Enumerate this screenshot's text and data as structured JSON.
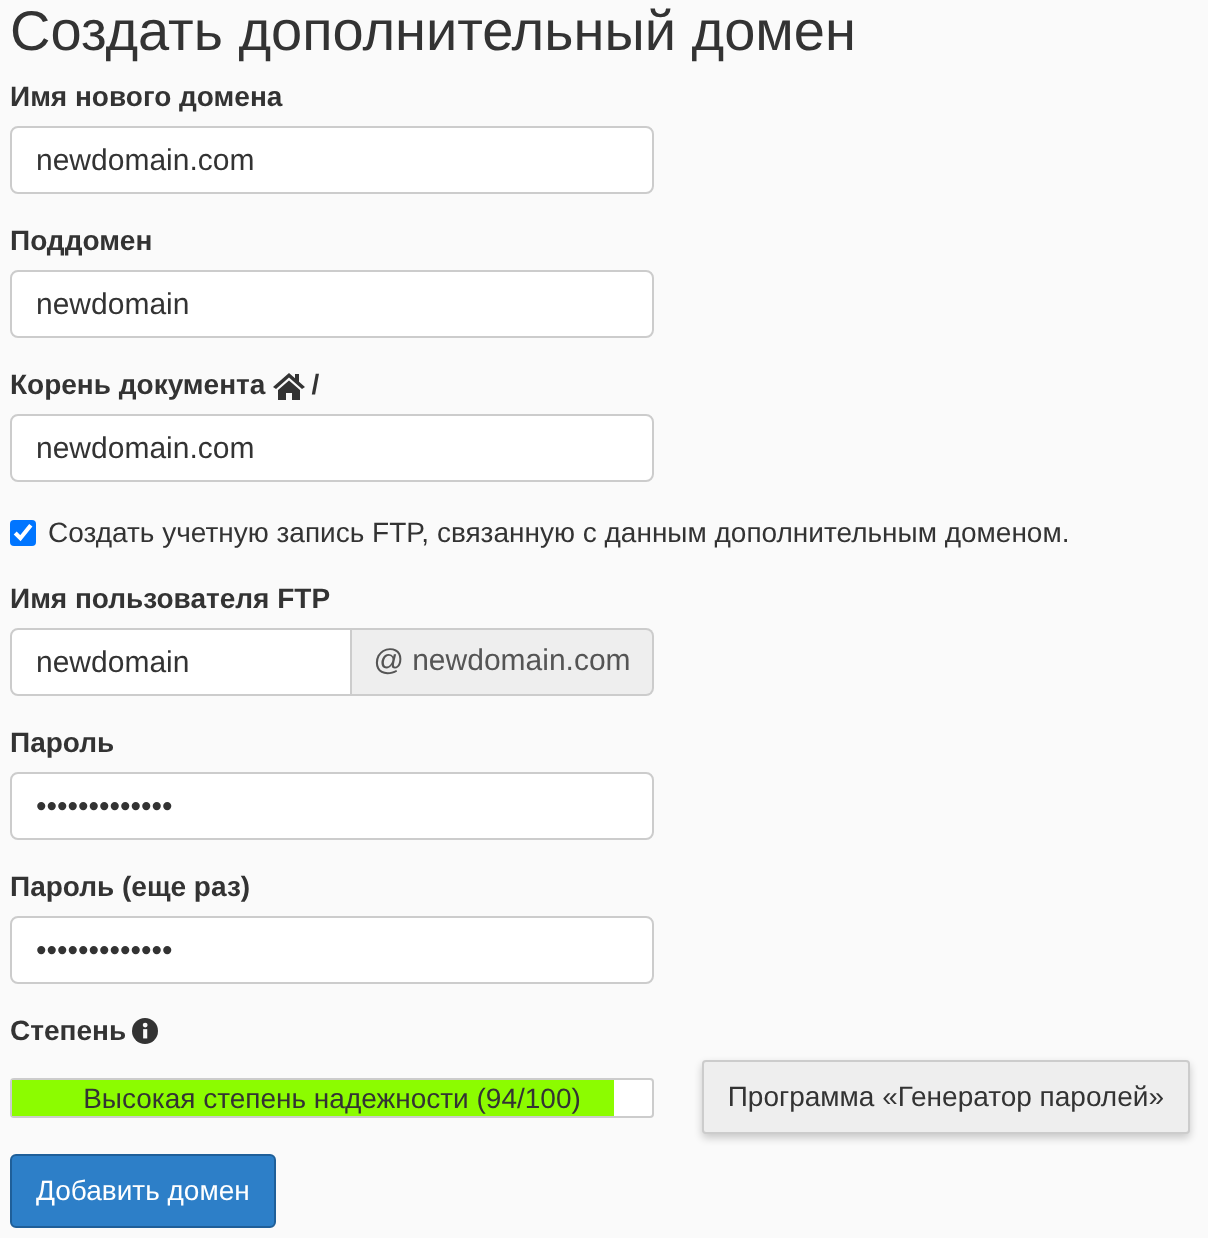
{
  "title": "Создать дополнительный домен",
  "fields": [
    {
      "label": "Имя нового домена",
      "value": "newdomain.com"
    },
    {
      "label": "Поддомен",
      "value": "newdomain"
    },
    {
      "label": "Корень документа",
      "label_suffix": "/",
      "value": "newdomain.com"
    }
  ],
  "ftp_checkbox": {
    "label": "Создать учетную запись FTP, связанную с данным дополнительным доменом.",
    "checked": true
  },
  "ftp_user": {
    "label": "Имя пользователя FTP",
    "value": "newdomain",
    "addon": "@ newdomain.com"
  },
  "passwords": [
    {
      "label": "Пароль",
      "value": "•••••••••••••"
    },
    {
      "label": "Пароль (еще раз)",
      "value": "•••••••••••••"
    }
  ],
  "strength": {
    "label": "Степень",
    "level": 0.94,
    "reading": "Высокая степень надежности (94/100)"
  },
  "generator_button": "Программа «Генератор паролей»",
  "submit_button": "Добавить домен"
}
